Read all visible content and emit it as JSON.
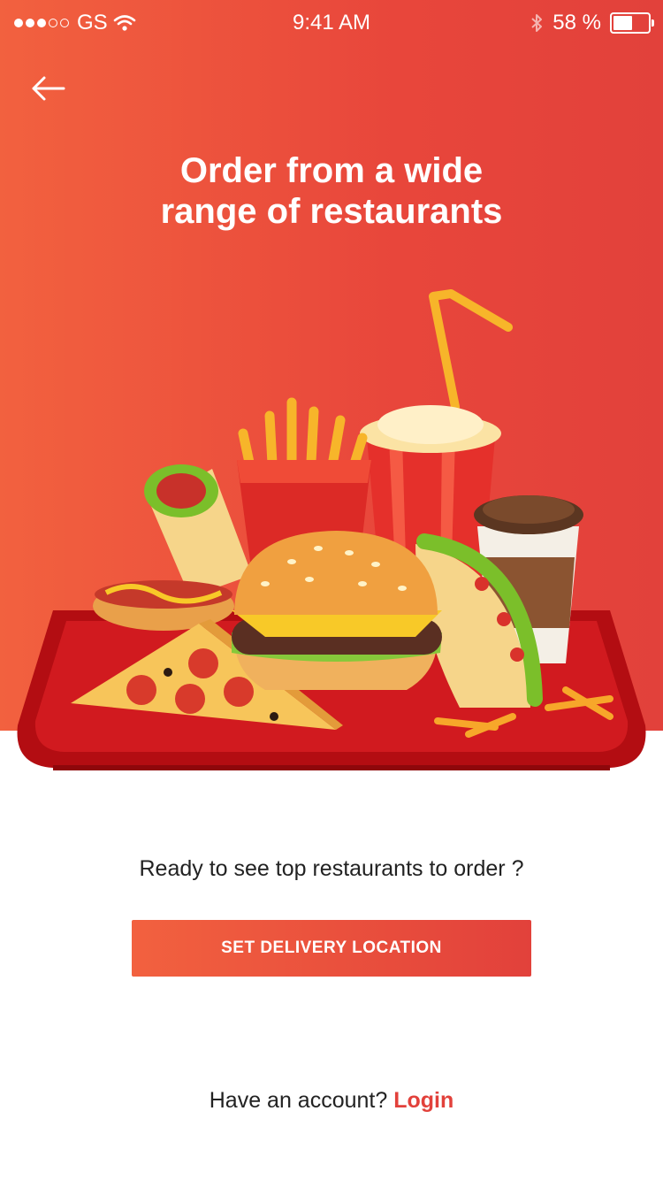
{
  "status_bar": {
    "carrier": "GS",
    "time": "9:41 AM",
    "battery": "58 %",
    "battery_level_percent": 58,
    "icons": [
      "signal-dots-icon",
      "wifi-icon",
      "bluetooth-icon",
      "battery-icon"
    ]
  },
  "header": {
    "back_icon": "back-arrow-icon",
    "title_line1": "Order from a wide",
    "title_line2": "range of restaurants"
  },
  "illustration": {
    "icon": "fast-food-tray-illustration"
  },
  "main": {
    "prompt": "Ready to see top restaurants to order ?",
    "cta_label": "SET DELIVERY LOCATION"
  },
  "footer": {
    "question": "Have an account?",
    "login_label": "Login"
  },
  "colors": {
    "accent_start": "#f2613f",
    "accent_end": "#e2413b",
    "text": "#222222",
    "background": "#ffffff"
  }
}
